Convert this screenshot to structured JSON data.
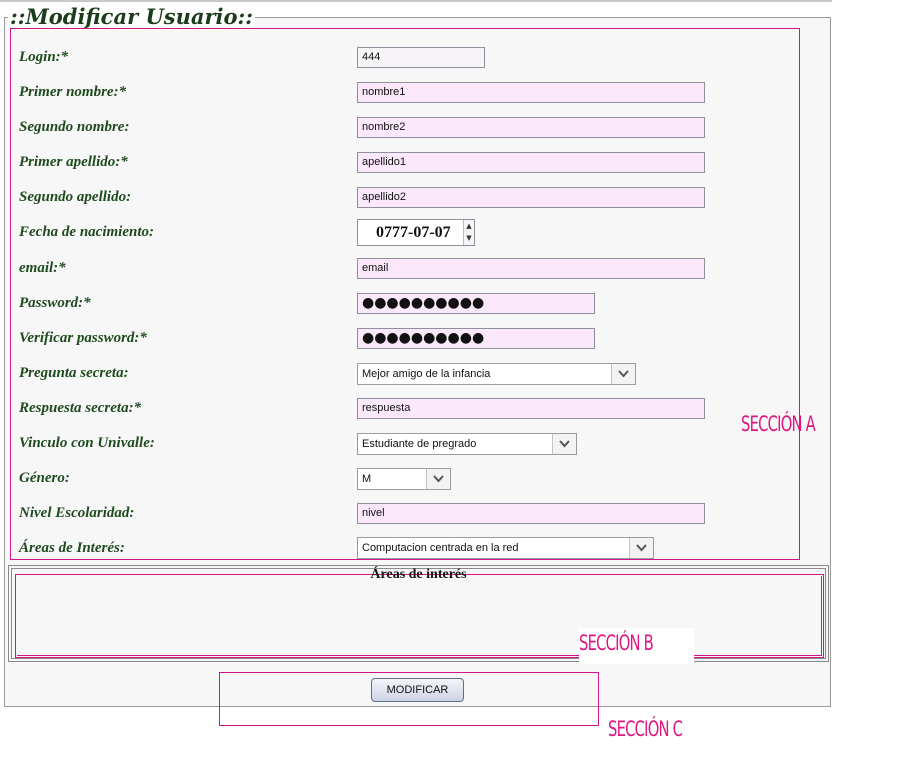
{
  "form": {
    "legend": "::Modificar Usuario::",
    "fields": {
      "login": {
        "label": "Login:*",
        "value": "444"
      },
      "primer_nombre": {
        "label": "Primer nombre:*",
        "value": "nombre1"
      },
      "segundo_nombre": {
        "label": "Segundo nombre:",
        "value": "nombre2"
      },
      "primer_apellido": {
        "label": "Primer apellido:*",
        "value": "apellido1"
      },
      "segundo_apellido": {
        "label": "Segundo apellido:",
        "value": "apellido2"
      },
      "fecha_nacimiento": {
        "label": "Fecha de nacimiento:",
        "value": "0777-07-07"
      },
      "email": {
        "label": "email:*",
        "value": "email"
      },
      "password": {
        "label": "Password:*",
        "value": "●●●●●●●●●●"
      },
      "verificar_password": {
        "label": "Verificar password:*",
        "value": "●●●●●●●●●●"
      },
      "pregunta_secreta": {
        "label": "Pregunta secreta:",
        "value": "Mejor amigo de la infancia"
      },
      "respuesta_secreta": {
        "label": "Respuesta secreta:*",
        "value": "respuesta"
      },
      "vinculo": {
        "label": "Vinculo con Univalle:",
        "value": "Estudiante de pregrado"
      },
      "genero": {
        "label": "Género:",
        "value": "M"
      },
      "nivel_escolaridad": {
        "label": "Nivel Escolaridad:",
        "value": "nivel"
      },
      "areas_interes": {
        "label": "Áreas de Interés:",
        "value": "Computacion centrada en la red"
      }
    },
    "areas_box_title": "Áreas de interés",
    "submit_label": "MODIFICAR"
  },
  "annotations": {
    "seccion_a": "SECCIÓN A",
    "seccion_b": "SECCIÓN B",
    "seccion_c": "SECCIÓN C",
    "color": "#e0157f"
  },
  "colors": {
    "label_text": "#1e4a1e",
    "input_bg": "#fbe8fb",
    "section_border": "#d4148c"
  }
}
